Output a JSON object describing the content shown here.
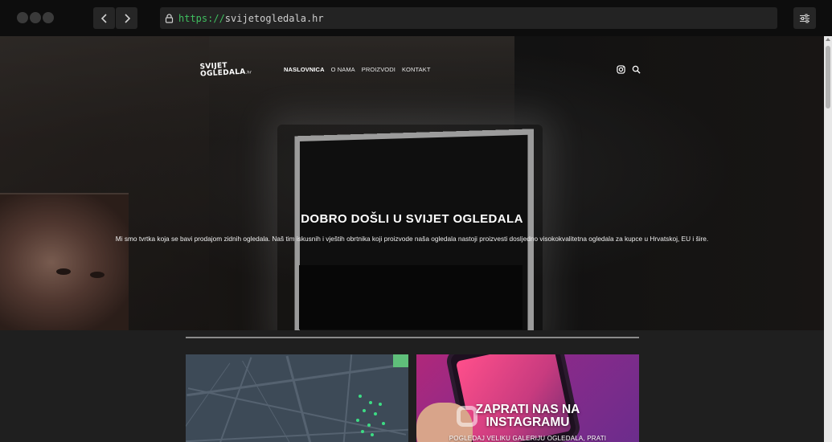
{
  "browser": {
    "url_scheme": "https://",
    "url_host": "svijetogledala.hr",
    "icons": {
      "back": "chevron-left-icon",
      "forward": "chevron-right-icon",
      "lock": "lock-icon",
      "menu": "sliders-icon"
    }
  },
  "site": {
    "logo_line1": "SVIJET",
    "logo_line2": "OGLEDALA",
    "logo_suffix": ".hr",
    "nav": [
      {
        "label": "NASLOVNICA",
        "active": true
      },
      {
        "label": "O NAMA",
        "active": false
      },
      {
        "label": "PROIZVODI",
        "active": false
      },
      {
        "label": "KONTAKT",
        "active": false
      }
    ],
    "header_icons": [
      "instagram-icon",
      "search-icon"
    ]
  },
  "hero": {
    "title": "DOBRO DOŠLI U SVIJET OGLEDALA",
    "subtitle": "Mi smo tvrtka koja se bavi prodajom zidnih ogledala. Naš tim iskusnih i vještih obrtnika koji proizvode naša ogledala nastoji proizvesti dosljedno visokokvalitetna ogledala za kupce u Hrvatskoj, EU i šire."
  },
  "cards": {
    "instagram_title_line1": "ZAPRATI NAS NA",
    "instagram_title_line2": "INSTAGRAMU",
    "instagram_sub": "POGLEDAJ VELIKU GALERIJU OGLEDALA, PRATI"
  },
  "colors": {
    "scheme_green": "#3fbf5f",
    "chrome_bg": "#0d0d0d",
    "page_bg": "#1f1f1f"
  }
}
